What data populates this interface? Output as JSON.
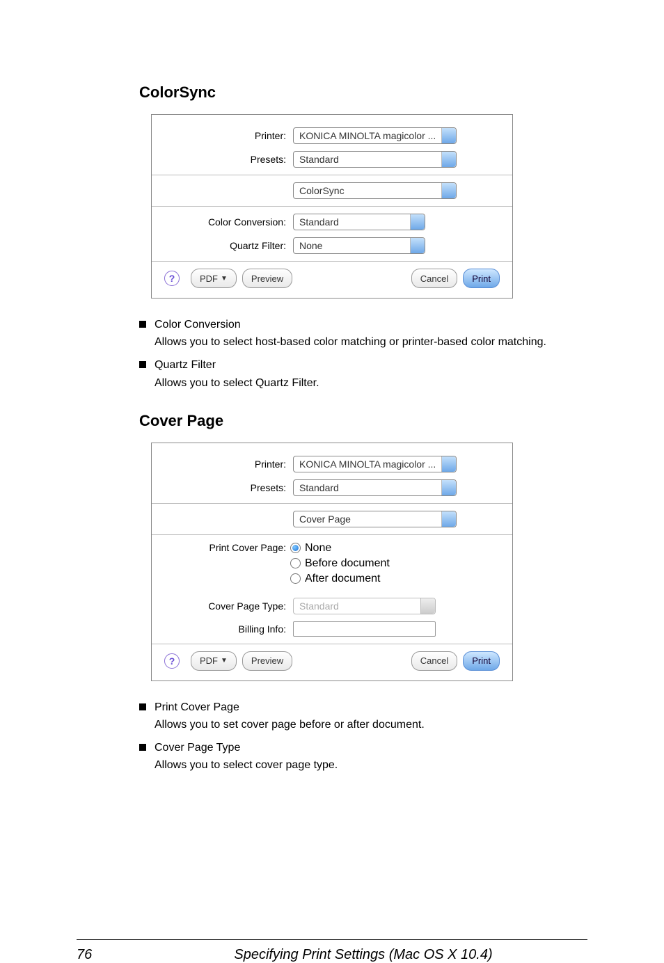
{
  "section1": {
    "title": "ColorSync",
    "dialog": {
      "printer_label": "Printer:",
      "printer_value": "KONICA MINOLTA magicolor ...",
      "presets_label": "Presets:",
      "presets_value": "Standard",
      "pane_value": "ColorSync",
      "cc_label": "Color Conversion:",
      "cc_value": "Standard",
      "qf_label": "Quartz Filter:",
      "qf_value": "None",
      "help": "?",
      "pdf": "PDF",
      "preview": "Preview",
      "cancel": "Cancel",
      "print": "Print"
    },
    "items": [
      {
        "title": "Color Conversion",
        "desc": "Allows you to select host-based color matching or printer-based color matching."
      },
      {
        "title": "Quartz Filter",
        "desc": "Allows you to select Quartz Filter."
      }
    ]
  },
  "section2": {
    "title": "Cover Page",
    "dialog": {
      "printer_label": "Printer:",
      "printer_value": "KONICA MINOLTA magicolor ...",
      "presets_label": "Presets:",
      "presets_value": "Standard",
      "pane_value": "Cover Page",
      "pcp_label": "Print Cover Page:",
      "radios": {
        "none": "None",
        "before": "Before document",
        "after": "After document"
      },
      "cpt_label": "Cover Page Type:",
      "cpt_value": "Standard",
      "billing_label": "Billing Info:",
      "help": "?",
      "pdf": "PDF",
      "preview": "Preview",
      "cancel": "Cancel",
      "print": "Print"
    },
    "items": [
      {
        "title": "Print Cover Page",
        "desc": "Allows you to set cover page before or after document."
      },
      {
        "title": "Cover Page Type",
        "desc": "Allows you to select cover page type."
      }
    ]
  },
  "footer": {
    "page": "76",
    "chapter": "Specifying Print Settings (Mac OS X 10.4)"
  }
}
